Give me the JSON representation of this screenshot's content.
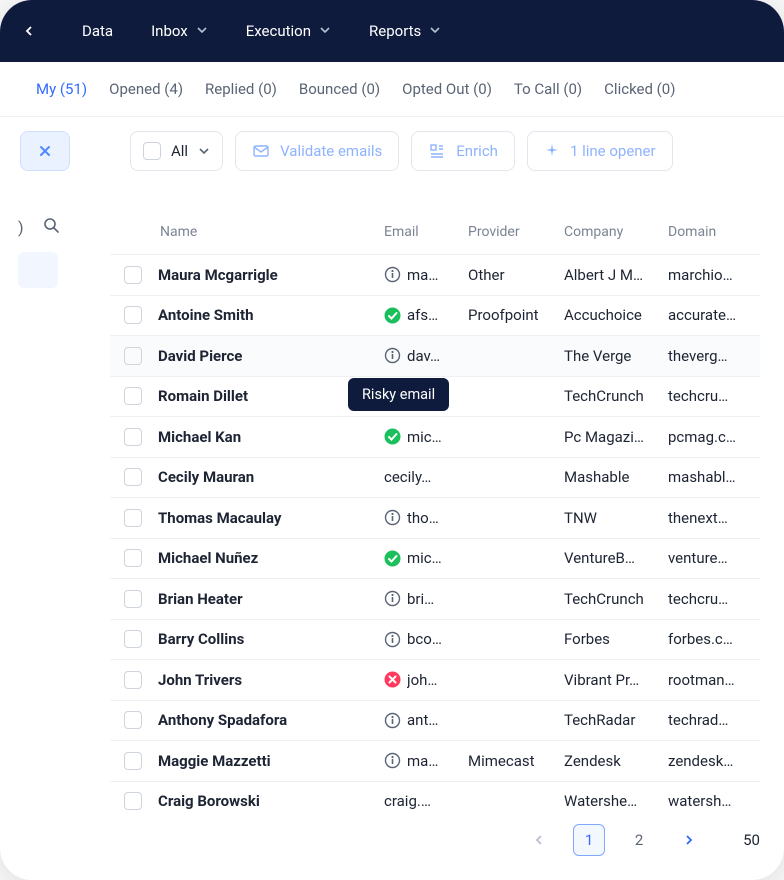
{
  "nav": {
    "items": [
      "Data",
      "Inbox",
      "Execution",
      "Reports"
    ]
  },
  "tabs": [
    {
      "label": "My (51)",
      "active": true
    },
    {
      "label": "Opened (4)"
    },
    {
      "label": "Replied (0)"
    },
    {
      "label": "Bounced (0)"
    },
    {
      "label": "Opted Out (0)"
    },
    {
      "label": "To Call (0)"
    },
    {
      "label": "Clicked (0)"
    }
  ],
  "toolbar": {
    "all_label": "All",
    "validate_label": "Validate emails",
    "enrich_label": "Enrich",
    "opener_label": "1 line opener"
  },
  "columns": {
    "name": "Name",
    "email": "Email",
    "provider": "Provider",
    "company": "Company",
    "domain": "Domain"
  },
  "tooltip": "Risky email",
  "rows": [
    {
      "name": "Maura Mcgarrigle",
      "email": "ma…",
      "status": "info",
      "provider": "Other",
      "company": "Albert J M…",
      "domain": "marchio…"
    },
    {
      "name": "Antoine Smith",
      "email": "afs…",
      "status": "ok",
      "provider": "Proofpoint",
      "company": "Accuchoice",
      "domain": "accurate…"
    },
    {
      "name": "David Pierce",
      "email": "dav…",
      "status": "info",
      "provider": "",
      "company": "The Verge",
      "domain": "theverg…",
      "hover": true
    },
    {
      "name": "Romain Dillet",
      "email": "",
      "status": "",
      "provider": "",
      "company": "TechCrunch",
      "domain": "techcru…"
    },
    {
      "name": "Michael Kan",
      "email": "mic…",
      "status": "ok",
      "provider": "",
      "company": "Pc Magazi…",
      "domain": "pcmag.c…"
    },
    {
      "name": "Cecily Mauran",
      "email": "cecily.…",
      "status": "",
      "provider": "",
      "company": "Mashable",
      "domain": "mashabl…"
    },
    {
      "name": "Thomas Macaulay",
      "email": "tho…",
      "status": "info",
      "provider": "",
      "company": "TNW",
      "domain": "thenext…"
    },
    {
      "name": "Michael Nuñez",
      "email": "mic…",
      "status": "ok",
      "provider": "",
      "company": "VentureB…",
      "domain": "venture…"
    },
    {
      "name": "Brian Heater",
      "email": "bri…",
      "status": "info",
      "provider": "",
      "company": "TechCrunch",
      "domain": "techcru…"
    },
    {
      "name": "Barry Collins",
      "email": "bco…",
      "status": "info",
      "provider": "",
      "company": "Forbes",
      "domain": "forbes.c…"
    },
    {
      "name": "John Trivers",
      "email": "joh…",
      "status": "bad",
      "provider": "",
      "company": "Vibrant Pr…",
      "domain": "rootman…"
    },
    {
      "name": "Anthony Spadafora",
      "email": "ant…",
      "status": "info",
      "provider": "",
      "company": "TechRadar",
      "domain": "techrad…"
    },
    {
      "name": "Maggie Mazzetti",
      "email": "ma…",
      "status": "info",
      "provider": "Mimecast",
      "company": "Zendesk",
      "domain": "zendesk…"
    },
    {
      "name": "Craig Borowski",
      "email": "craig.b…",
      "status": "",
      "provider": "",
      "company": "Watershe…",
      "domain": "watersh…"
    }
  ],
  "pager": {
    "pages": [
      "1",
      "2"
    ],
    "active": "1",
    "total": "50"
  }
}
